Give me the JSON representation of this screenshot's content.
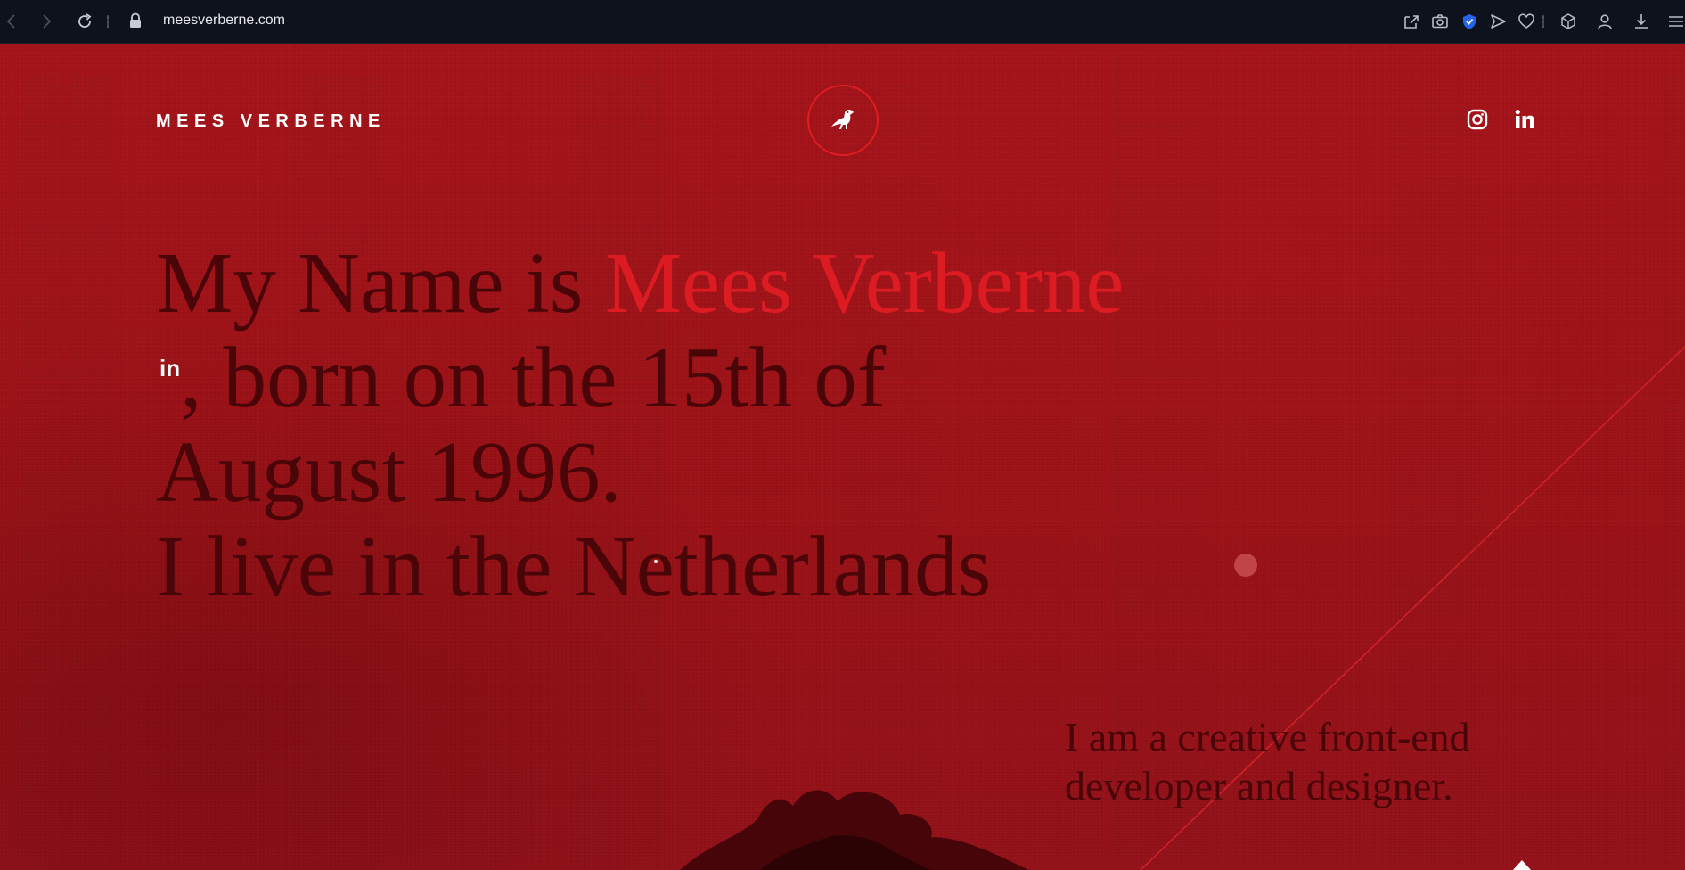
{
  "browser": {
    "url": "meesverberne.com",
    "icons": [
      "back-icon",
      "forward-icon",
      "reload-icon",
      "lock-icon",
      "share-icon",
      "camera-icon",
      "shield-icon",
      "send-icon",
      "heart-icon",
      "box-icon",
      "profile-icon",
      "download-icon",
      "menu-icon"
    ]
  },
  "header": {
    "brand": "MEES VERBERNE",
    "logo_icon": "crow-icon",
    "socials": [
      "instagram-icon",
      "linkedin-icon"
    ]
  },
  "hero": {
    "part1": "My Name is ",
    "name": "Mees Verberne",
    "linkedin_sup": "in",
    "part2": ", born on the 15th of August 1996.",
    "line4": "I live in the Netherlands"
  },
  "intro": {
    "text": "I am a creative front-end developer and designer."
  },
  "colors": {
    "background": "#a5141a",
    "accent": "#dd1b22",
    "text_dark": "#4a0508",
    "chrome": "#0e121d"
  }
}
